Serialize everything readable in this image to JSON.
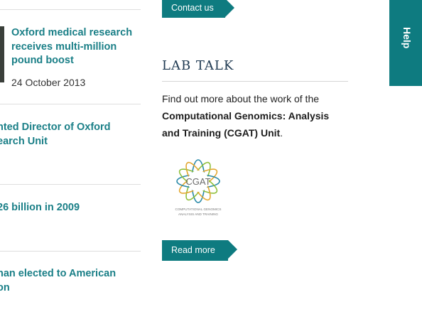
{
  "contact_button": {
    "label": "Contact us"
  },
  "news": [
    {
      "title_lines": [
        "Oxford medical research",
        "receives multi-million",
        "pound boost"
      ],
      "date": "24 October 2013"
    },
    {
      "title_lines": [
        "nted Director of Oxford",
        "earch Unit"
      ]
    },
    {
      "title_lines": [
        "26 billion in 2009"
      ]
    },
    {
      "title_lines": [
        "nan elected to American",
        "on"
      ]
    }
  ],
  "lab_talk": {
    "heading": "LAB TALK",
    "intro": "Find out more about the work of the",
    "unit_name": "Computational Genomics: Analysis and Training (CGAT) Unit",
    "period": ".",
    "logo": {
      "acronym": "CGAT",
      "tagline_1": "COMPUTATIONAL GENOMICS",
      "tagline_2": "ANALYSIS AND TRAINING"
    },
    "read_more": "Read more"
  },
  "help_tab": {
    "label": "Help"
  },
  "colors": {
    "accent": "#0e7b80",
    "link": "#1a7f87",
    "heading": "#1f3a52"
  }
}
